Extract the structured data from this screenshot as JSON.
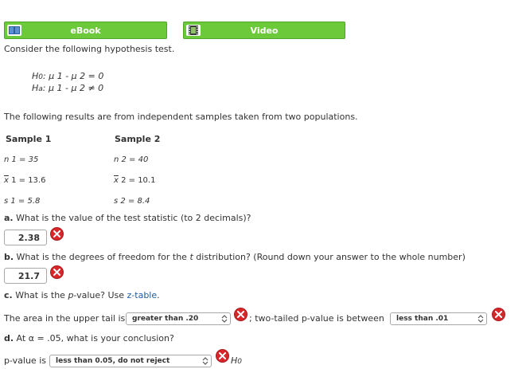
{
  "toolbar": {
    "ebook_label": "eBook",
    "video_label": "Video",
    "ebook_icon": "book-icon",
    "video_icon": "film-icon"
  },
  "intro": "Consider the following hypothesis test.",
  "hypotheses": {
    "h0_prefix": "H",
    "h0_sub": "0",
    "h0_body": ": μ 1 - μ 2 = 0",
    "ha_prefix": "H",
    "ha_sub": "a",
    "ha_body": ": μ 1 - μ 2 ≠ 0"
  },
  "results_intro": "The following results are from independent samples taken from two populations.",
  "samples": {
    "header1": "Sample 1",
    "header2": "Sample 2",
    "n1": "n 1 = 35",
    "n2": "n 2 = 40",
    "x1_sym": "x",
    "x1_rest": " 1 = 13.6",
    "x2_sym": "x",
    "x2_rest": " 2 = 10.1",
    "s1": "s 1 = 5.8",
    "s2": "s 2 = 8.4"
  },
  "questions": {
    "a_label": "a.",
    "a_text": " What is the value of the test statistic (to 2 decimals)?",
    "a_answer": "2.38",
    "b_label": "b.",
    "b_text_1": " What is the degrees of freedom for the ",
    "b_text_t": "t",
    "b_text_2": " distribution? (Round down your answer to the whole number)",
    "b_answer": "21.7",
    "c_label": "c.",
    "c_text_1": " What is the ",
    "c_text_p": "p",
    "c_text_2": "-value? Use ",
    "c_link": "z-table",
    "c_text_3": ".",
    "upper_tail_text": "The area in the upper tail is",
    "upper_tail_value": "greater than .20",
    "two_tailed_text": "; two-tailed p-value is between",
    "two_tailed_value": "less than .01",
    "d_label": "d.",
    "d_text": " At α = .05, what is your conclusion?",
    "conclusion_prefix": "p-value is",
    "conclusion_value": "less than 0.05, do not reject",
    "conclusion_suffix_h": "H",
    "conclusion_suffix_sub": "0"
  },
  "colors": {
    "button_green": "#6cc93a",
    "error_red": "#d9262b",
    "link_blue": "#1c5d9e"
  }
}
